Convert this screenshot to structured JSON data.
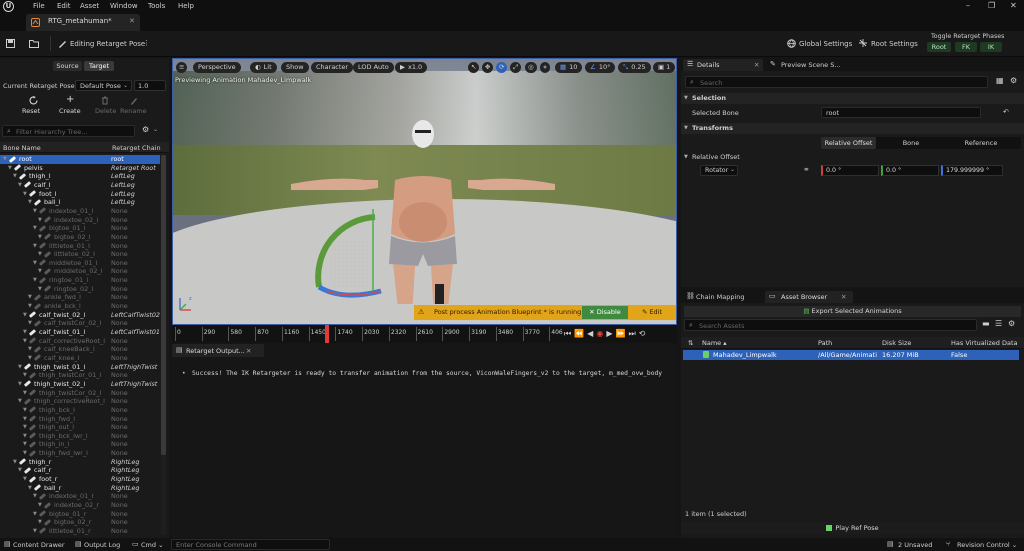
{
  "menu": {
    "logo": "U",
    "items": [
      "File",
      "Edit",
      "Asset",
      "Window",
      "Tools",
      "Help"
    ]
  },
  "window": {
    "minimize": "–",
    "restore": "❐",
    "close": "✕"
  },
  "doc_tab": {
    "title": "RTG_metahuman*",
    "close": "✕"
  },
  "toolbar": {
    "mode_label": "Editing Retarget Pose",
    "global_settings": "Global Settings",
    "root_settings": "Root Settings",
    "toggle_phases_title": "Toggle Retarget Phases",
    "phases": [
      "Root",
      "FK",
      "IK"
    ]
  },
  "left_panel": {
    "tabs": [
      "Source",
      "Target"
    ],
    "current_pose_label": "Current Retarget Pose",
    "current_pose_value": "Default Pose",
    "blend_value": "1.0",
    "actions": [
      "Reset",
      "Create",
      "Delete",
      "Rename"
    ],
    "filter_placeholder": "Filter Hierarchy Tree...",
    "col_bone": "Bone Name",
    "col_chain": "Retarget Chain",
    "rows": [
      {
        "bone": "root",
        "chain": "root",
        "state": "sel",
        "indent": 0
      },
      {
        "bone": "pelvis",
        "chain": "Retarget Root",
        "state": "act",
        "indent": 1
      },
      {
        "bone": "thigh_l",
        "chain": "LeftLeg",
        "state": "act",
        "indent": 2
      },
      {
        "bone": "calf_l",
        "chain": "LeftLeg",
        "state": "act",
        "indent": 3
      },
      {
        "bone": "foot_l",
        "chain": "LeftLeg",
        "state": "act",
        "indent": 4
      },
      {
        "bone": "ball_l",
        "chain": "LeftLeg",
        "state": "act",
        "indent": 5
      },
      {
        "bone": "indextoe_01_l",
        "chain": "None",
        "state": "dim",
        "indent": 6
      },
      {
        "bone": "indextoe_02_l",
        "chain": "None",
        "state": "dim",
        "indent": 7
      },
      {
        "bone": "bigtoe_01_l",
        "chain": "None",
        "state": "dim",
        "indent": 6
      },
      {
        "bone": "bigtoe_02_l",
        "chain": "None",
        "state": "dim",
        "indent": 7
      },
      {
        "bone": "littletoe_01_l",
        "chain": "None",
        "state": "dim",
        "indent": 6
      },
      {
        "bone": "littletoe_02_l",
        "chain": "None",
        "state": "dim",
        "indent": 7
      },
      {
        "bone": "middletoe_01_l",
        "chain": "None",
        "state": "dim",
        "indent": 6
      },
      {
        "bone": "middletoe_02_l",
        "chain": "None",
        "state": "dim",
        "indent": 7
      },
      {
        "bone": "ringtoe_01_l",
        "chain": "None",
        "state": "dim",
        "indent": 6
      },
      {
        "bone": "ringtoe_02_l",
        "chain": "None",
        "state": "dim",
        "indent": 7
      },
      {
        "bone": "ankle_fwd_l",
        "chain": "None",
        "state": "dim",
        "indent": 5
      },
      {
        "bone": "ankle_bck_l",
        "chain": "None",
        "state": "dim",
        "indent": 5
      },
      {
        "bone": "calf_twist_02_l",
        "chain": "LeftCalfTwist02",
        "state": "act",
        "indent": 4
      },
      {
        "bone": "calf_twistCor_02_l",
        "chain": "None",
        "state": "dim",
        "indent": 5
      },
      {
        "bone": "calf_twist_01_l",
        "chain": "LeftCalfTwist01",
        "state": "act",
        "indent": 4
      },
      {
        "bone": "calf_correctiveRoot_l",
        "chain": "None",
        "state": "dim",
        "indent": 4
      },
      {
        "bone": "calf_kneeBack_l",
        "chain": "None",
        "state": "dim",
        "indent": 5
      },
      {
        "bone": "calf_knee_l",
        "chain": "None",
        "state": "dim",
        "indent": 5
      },
      {
        "bone": "thigh_twist_01_l",
        "chain": "LeftThighTwist",
        "state": "act",
        "indent": 3
      },
      {
        "bone": "thigh_twistCor_01_l",
        "chain": "None",
        "state": "dim",
        "indent": 4
      },
      {
        "bone": "thigh_twist_02_l",
        "chain": "LeftThighTwist",
        "state": "act",
        "indent": 3
      },
      {
        "bone": "thigh_twistCor_02_l",
        "chain": "None",
        "state": "dim",
        "indent": 4
      },
      {
        "bone": "thigh_correctiveRoot_l",
        "chain": "None",
        "state": "dim",
        "indent": 3
      },
      {
        "bone": "thigh_bck_l",
        "chain": "None",
        "state": "dim",
        "indent": 4
      },
      {
        "bone": "thigh_fwd_l",
        "chain": "None",
        "state": "dim",
        "indent": 4
      },
      {
        "bone": "thigh_out_l",
        "chain": "None",
        "state": "dim",
        "indent": 4
      },
      {
        "bone": "thigh_bck_lwr_l",
        "chain": "None",
        "state": "dim",
        "indent": 4
      },
      {
        "bone": "thigh_in_l",
        "chain": "None",
        "state": "dim",
        "indent": 4
      },
      {
        "bone": "thigh_fwd_lwr_l",
        "chain": "None",
        "state": "dim",
        "indent": 4
      },
      {
        "bone": "thigh_r",
        "chain": "RightLeg",
        "state": "act",
        "indent": 2
      },
      {
        "bone": "calf_r",
        "chain": "RightLeg",
        "state": "act",
        "indent": 3
      },
      {
        "bone": "foot_r",
        "chain": "RightLeg",
        "state": "act",
        "indent": 4
      },
      {
        "bone": "ball_r",
        "chain": "RightLeg",
        "state": "act",
        "indent": 5
      },
      {
        "bone": "indextoe_01_r",
        "chain": "None",
        "state": "dim",
        "indent": 6
      },
      {
        "bone": "indextoe_02_r",
        "chain": "None",
        "state": "dim",
        "indent": 7
      },
      {
        "bone": "bigtoe_01_r",
        "chain": "None",
        "state": "dim",
        "indent": 6
      },
      {
        "bone": "bigtoe_02_r",
        "chain": "None",
        "state": "dim",
        "indent": 7
      },
      {
        "bone": "littletoe_01_r",
        "chain": "None",
        "state": "dim",
        "indent": 6
      }
    ]
  },
  "viewport": {
    "menu_icon": "≡",
    "perspective": "Perspective",
    "lit": "Lit",
    "show": "Show",
    "character": "Character",
    "lod": "LOD Auto",
    "speed": "x1.0",
    "grid_snap": "10",
    "rot_snap": "10°",
    "scale_snap": "0.25",
    "cam_speed": "1",
    "preview_text": "Previewing Animation Mahadev_Limpwalk",
    "banner": "Post process Animation Blueprint * is running.",
    "disable_btn": "Disable",
    "edit_btn": "Edit"
  },
  "timeline": {
    "ticks": [
      "0",
      "290",
      "580",
      "870",
      "1160",
      "1450",
      "1740",
      "2030",
      "2320",
      "2610",
      "2900",
      "3190",
      "3480",
      "3770",
      "406"
    ],
    "playhead": 1580,
    "max": 4060
  },
  "output": {
    "tab": "Retarget Output...",
    "message": "Success! The IK Retargeter is ready to transfer animation from the source, ViconWaleFingers_v2 to the target, m_med_ovw_body"
  },
  "details": {
    "tab": "Details",
    "tab2": "Preview Scene S...",
    "search_placeholder": "Search",
    "selection_header": "Selection",
    "selected_bone_label": "Selected Bone",
    "selected_bone_value": "root",
    "transforms_header": "Transforms",
    "transform_tabs": [
      "Relative Offset",
      "Bone",
      "Reference"
    ],
    "relative_offset_label": "Relative Offset",
    "rotator_label": "Rotator",
    "rot_x": "0.0 °",
    "rot_y": "0.0 °",
    "rot_z": "179.999999 °"
  },
  "assets": {
    "tab1": "Chain Mapping",
    "tab2": "Asset Browser",
    "export_btn": "Export Selected Animations",
    "search_placeholder": "Search Assets",
    "columns": [
      "Name",
      "Path",
      "Disk Size",
      "Has Virtualized Data"
    ],
    "rows": [
      {
        "name": "Mahadev_Limpwalk",
        "path": "/All/Game/Animati",
        "size": "16.207 MiB",
        "virt": "False"
      }
    ],
    "count": "1 item (1 selected)",
    "play_ref": "Play Ref Pose"
  },
  "status": {
    "content_drawer": "Content Drawer",
    "output_log": "Output Log",
    "cmd": "Cmd",
    "console_placeholder": "Enter Console Command",
    "unsaved": "2 Unsaved",
    "revision": "Revision Control"
  },
  "colors": {
    "accent": "#2e62b8",
    "phase_green": "#1f3a23",
    "banner_yellow": "#e2a418",
    "disable_green": "#3f8a3f"
  }
}
